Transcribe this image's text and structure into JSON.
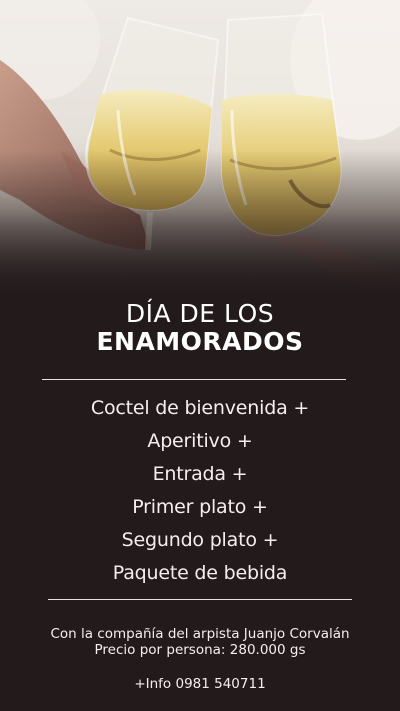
{
  "title": {
    "line1": "DÍA DE LOS",
    "line2": "ENAMORADOS"
  },
  "menu": {
    "items": [
      "Coctel de bienvenida +",
      "Aperitivo +",
      "Entrada +",
      "Primer plato +",
      "Segundo plato +",
      "Paquete de bebida"
    ]
  },
  "footer": {
    "companion": "Con la compañía del arpista Juanjo Corvalán",
    "price": "Precio por persona:  280.000 gs",
    "contact": "+Info 0981 540711"
  },
  "colors": {
    "background": "#231a1b",
    "text": "#ffffff",
    "champagne": "#e6cf7c"
  }
}
